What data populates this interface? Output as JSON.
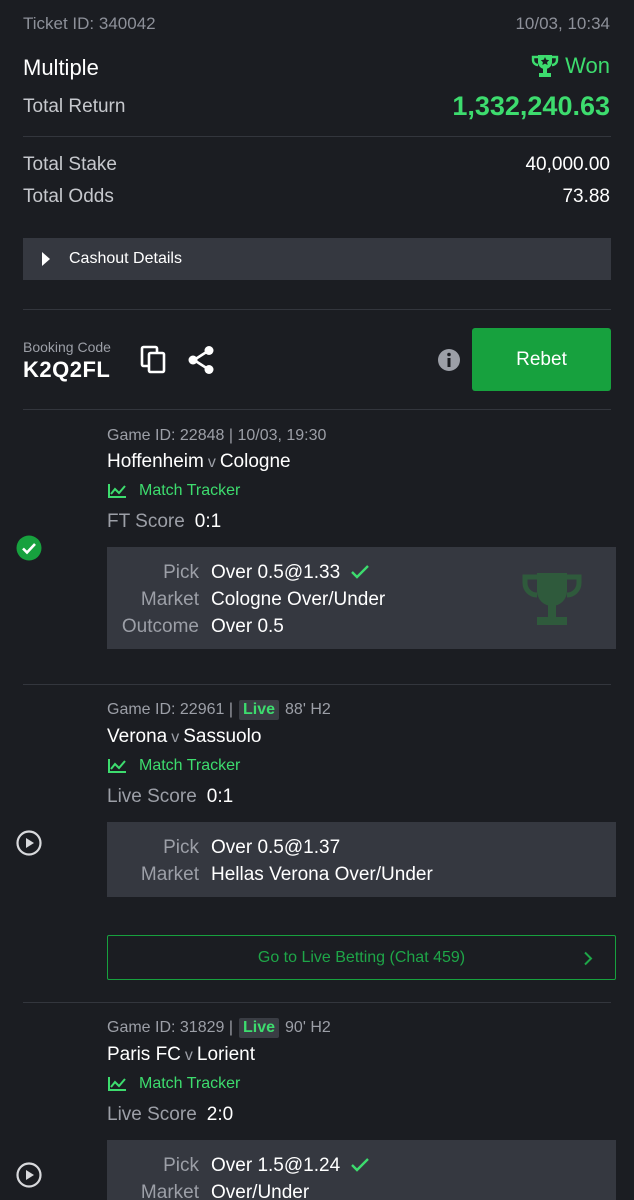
{
  "header": {
    "ticket_id": "Ticket ID: 340042",
    "date": "10/03, 10:34",
    "bet_type": "Multiple",
    "status": "Won",
    "total_return_label": "Total Return",
    "total_return_value": "1,332,240.63",
    "total_stake_label": "Total Stake",
    "total_stake_value": "40,000.00",
    "total_odds_label": "Total Odds",
    "total_odds_value": "73.88"
  },
  "cashout": {
    "label": "Cashout Details"
  },
  "booking": {
    "label": "Booking Code",
    "code": "K2Q2FL",
    "rebet_label": "Rebet"
  },
  "selections": [
    {
      "game_id": "Game ID: 22848 | 10/03, 19:30",
      "home": "Hoffenheim",
      "v": "v",
      "away": "Cologne",
      "tracker": "Match Tracker",
      "score_label": "FT Score",
      "score": "0:1",
      "pick_label": "Pick",
      "pick": "Over 0.5@1.33",
      "market_label": "Market",
      "market": "Cologne Over/Under",
      "outcome_label": "Outcome",
      "outcome": "Over 0.5"
    },
    {
      "game_id_prefix": "Game ID: 22961 |",
      "live": "Live",
      "time": "88' H2",
      "home": "Verona",
      "v": "v",
      "away": "Sassuolo",
      "tracker": "Match Tracker",
      "score_label": "Live Score",
      "score": "0:1",
      "pick_label": "Pick",
      "pick": "Over 0.5@1.37",
      "market_label": "Market",
      "market": "Hellas Verona Over/Under",
      "live_betting": "Go to Live Betting (Chat 459)"
    },
    {
      "game_id_prefix": "Game ID: 31829 |",
      "live": "Live",
      "time": "90' H2",
      "home": "Paris FC",
      "v": "v",
      "away": "Lorient",
      "tracker": "Match Tracker",
      "score_label": "Live Score",
      "score": "2:0",
      "pick_label": "Pick",
      "pick": "Over 1.5@1.24",
      "market_label": "Market",
      "market": "Over/Under"
    }
  ],
  "colors": {
    "background": "#1b1d22",
    "accent_green": "#3ddc6e",
    "button_green": "#17a13e",
    "panel": "#353840"
  }
}
